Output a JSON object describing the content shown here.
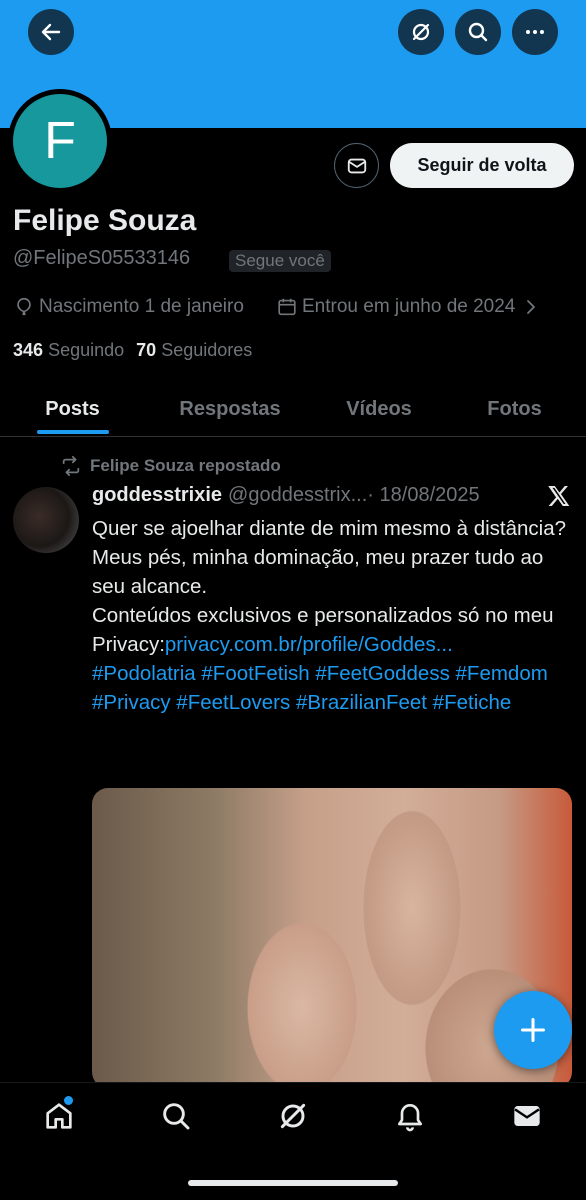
{
  "profile": {
    "avatar_letter": "F",
    "name": "Felipe Souza",
    "handle": "@FelipeS05533146",
    "follows_you": "Segue você",
    "follow_back_label": "Seguir de volta",
    "birth": "Nascimento 1 de janeiro",
    "joined": "Entrou em junho de 2024",
    "following_count": "346",
    "following_label": "Seguindo",
    "followers_count": "70",
    "followers_label": "Seguidores"
  },
  "tabs": [
    "Posts",
    "Respostas",
    "Vídeos",
    "Fotos"
  ],
  "post": {
    "repost_label": "Felipe Souza repostado",
    "author": "goddesstrixie",
    "handle": "@goddesstrix...",
    "date": "· 18/08/2025",
    "line1": "Quer se ajoelhar diante de mim mesmo à distância?",
    "line2": "Meus pés, minha dominação, meu prazer tudo ao seu alcance.",
    "line3_prefix": "Conteúdos exclusivos e personalizados só no meu Privacy:",
    "link": "privacy.com.br/profile/Goddes...",
    "hashtags": "#Podolatria #FootFetish #FeetGoddess #Femdom #Privacy #FeetLovers #BrazilianFeet #Fetiche"
  },
  "colors": {
    "accent": "#1d9bf0",
    "banner": "#1d9bf0",
    "avatar_bg": "#16989d",
    "muted_text": "#71767b"
  },
  "icons": {
    "back": "arrow-left-icon",
    "grok": "grok-icon",
    "search": "search-icon",
    "more": "more-horizontal-icon",
    "message": "envelope-icon",
    "birth": "balloon-icon",
    "joined": "calendar-icon",
    "repost": "repost-icon",
    "compose": "plus-icon",
    "nav": [
      "home-icon",
      "search-icon",
      "grok-icon",
      "bell-icon",
      "mail-icon"
    ]
  }
}
